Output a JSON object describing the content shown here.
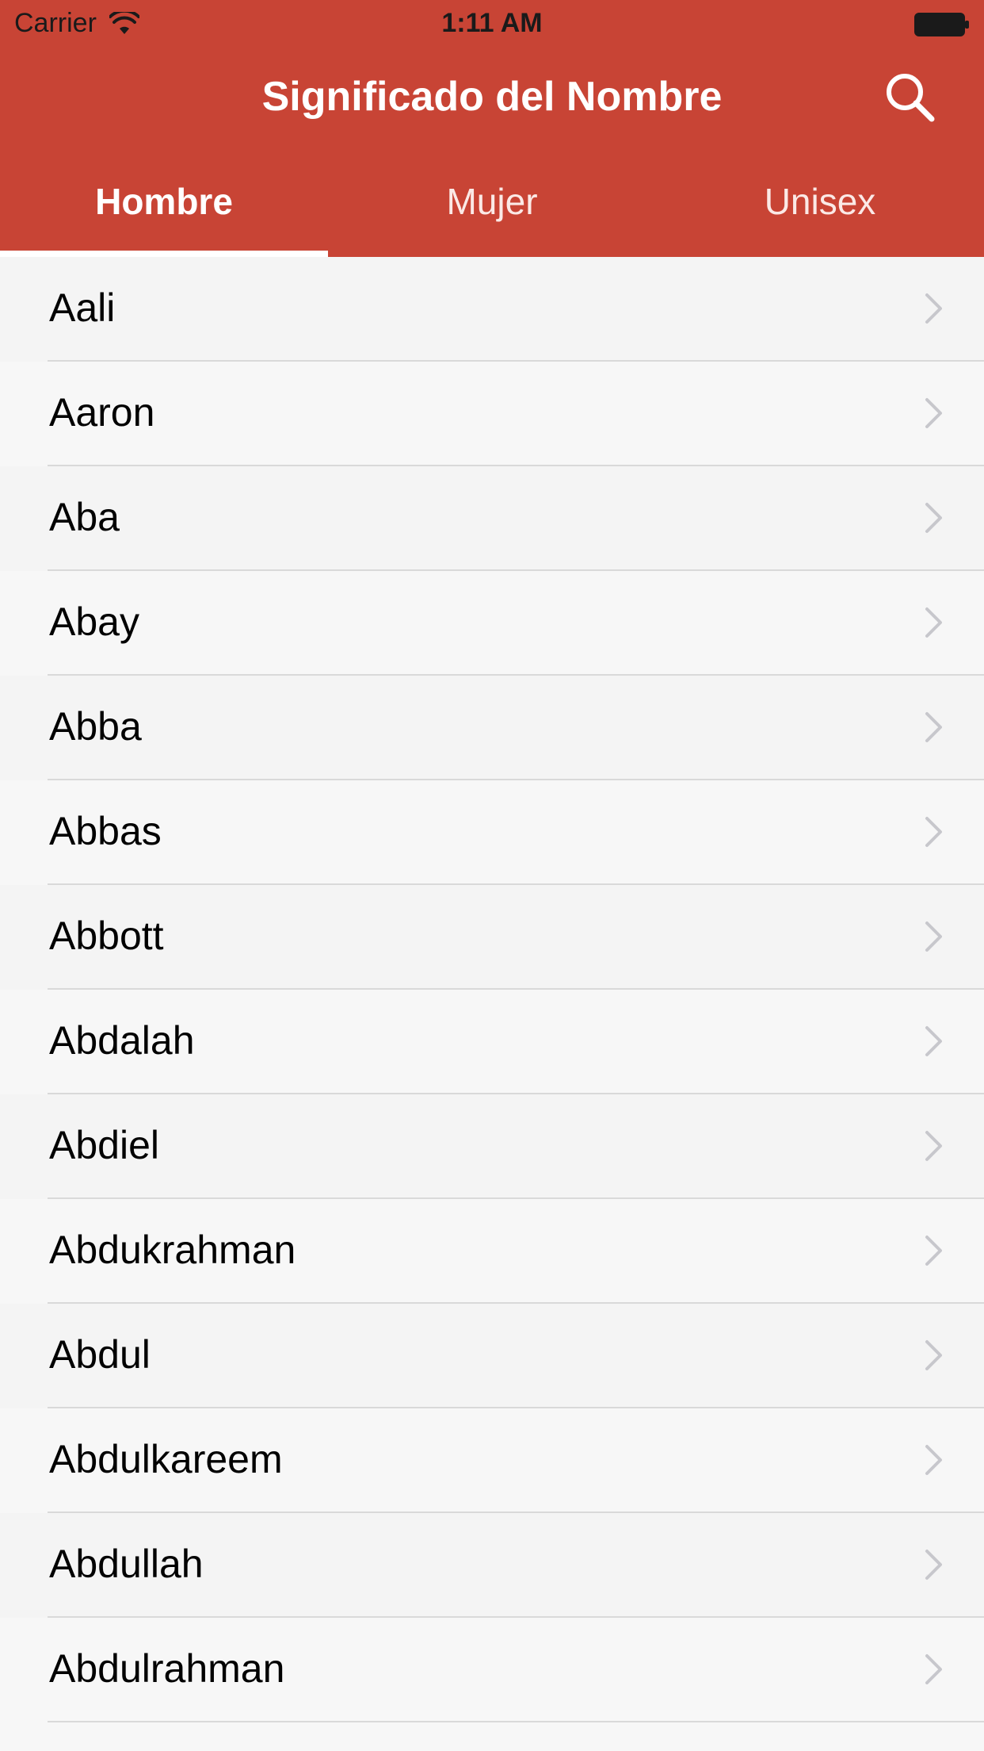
{
  "status_bar": {
    "carrier": "Carrier",
    "time": "1:11 AM",
    "icons": [
      "wifi-icon",
      "battery-icon"
    ]
  },
  "nav": {
    "title": "Significado del Nombre",
    "search_icon": "search-icon"
  },
  "tabs": [
    {
      "label": "Hombre",
      "active": true
    },
    {
      "label": "Mujer",
      "active": false
    },
    {
      "label": "Unisex",
      "active": false
    }
  ],
  "names": [
    "Aali",
    "Aaron",
    "Aba",
    "Abay",
    "Abba",
    "Abbas",
    "Abbott",
    "Abdalah",
    "Abdiel",
    "Abdukrahman",
    "Abdul",
    "Abdulkareem",
    "Abdullah",
    "Abdulrahman"
  ],
  "colors": {
    "header": "#c84435",
    "text": "#000000",
    "chevron": "#c7c7cc",
    "divider": "#d9d9d9"
  }
}
